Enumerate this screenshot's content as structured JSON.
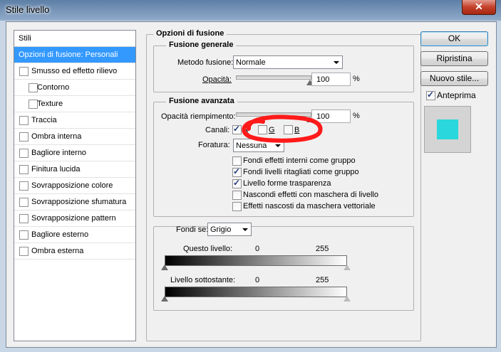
{
  "window": {
    "title": "Stile livello",
    "close_glyph": "✕"
  },
  "styles_list": {
    "header": "Stili",
    "items": [
      {
        "label": "Opzioni di fusione: Personali",
        "selected": true,
        "has_checkbox": false,
        "sub": false
      },
      {
        "label": "Smusso ed effetto rilievo",
        "has_checkbox": true,
        "sub": false
      },
      {
        "label": "Contorno",
        "has_checkbox": true,
        "sub": true
      },
      {
        "label": "Texture",
        "has_checkbox": true,
        "sub": true
      },
      {
        "label": "Traccia",
        "has_checkbox": true,
        "sub": false
      },
      {
        "label": "Ombra interna",
        "has_checkbox": true,
        "sub": false
      },
      {
        "label": "Bagliore interno",
        "has_checkbox": true,
        "sub": false
      },
      {
        "label": "Finitura lucida",
        "has_checkbox": true,
        "sub": false
      },
      {
        "label": "Sovrapposizione colore",
        "has_checkbox": true,
        "sub": false
      },
      {
        "label": "Sovrapposizione sfumatura",
        "has_checkbox": true,
        "sub": false
      },
      {
        "label": "Sovrapposizione pattern",
        "has_checkbox": true,
        "sub": false
      },
      {
        "label": "Bagliore esterno",
        "has_checkbox": true,
        "sub": false
      },
      {
        "label": "Ombra esterna",
        "has_checkbox": true,
        "sub": false
      }
    ]
  },
  "blending": {
    "title": "Opzioni di fusione",
    "general": {
      "title": "Fusione generale",
      "mode_label": "Metodo fusione:",
      "mode_value": "Normale",
      "opacity_label": "Opacità:",
      "opacity_value": "100",
      "opacity_unit": "%",
      "opacity_fraction": 1.0
    },
    "advanced": {
      "title": "Fusione avanzata",
      "fill_label": "Opacità riempimento:",
      "fill_value": "100",
      "fill_unit": "%",
      "fill_fraction": 1.0,
      "channels_label": "Canali:",
      "channels": [
        {
          "label": "R",
          "checked": true
        },
        {
          "label": "G",
          "checked": false
        },
        {
          "label": "B",
          "checked": false
        }
      ],
      "knockout_label": "Foratura:",
      "knockout_value": "Nessuna",
      "options": [
        {
          "label": "Fondi effetti interni come gruppo",
          "checked": false
        },
        {
          "label": "Fondi livelli ritagliati come gruppo",
          "checked": true
        },
        {
          "label": "Livello forme trasparenza",
          "checked": true
        },
        {
          "label": "Nascondi effetti con maschera di livello",
          "checked": false
        },
        {
          "label": "Effetti nascosti da maschera vettoriale",
          "checked": false
        }
      ]
    },
    "blend_if": {
      "label": "Fondi se:",
      "value": "Grigio",
      "this_layer_label": "Questo livello:",
      "this_layer_min": "0",
      "this_layer_max": "255",
      "underlying_label": "Livello sottostante:",
      "underlying_min": "0",
      "underlying_max": "255"
    }
  },
  "buttons": {
    "ok": "OK",
    "reset": "Ripristina",
    "new_style": "Nuovo stile...",
    "preview_label": "Anteprima",
    "preview_checked": true
  },
  "colors": {
    "selection": "#3399ff",
    "preview_swatch": "#2ad7dc",
    "annotation_stroke": "#ff1a1a"
  }
}
